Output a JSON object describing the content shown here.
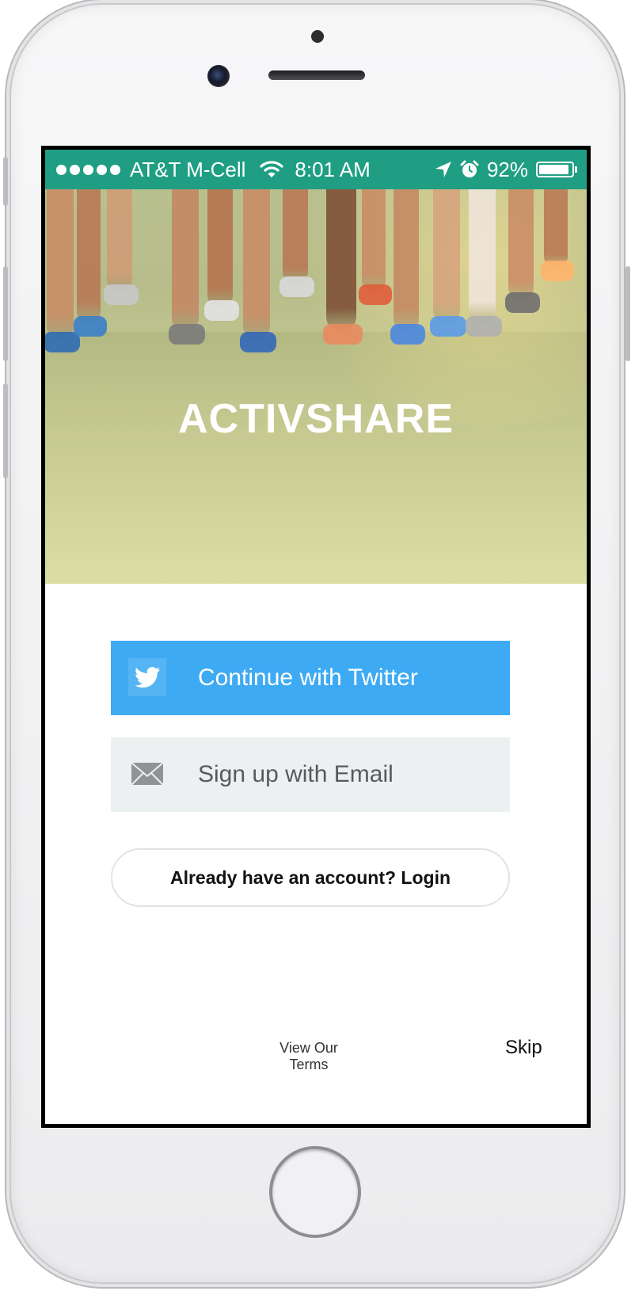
{
  "status_bar": {
    "carrier": "AT&T M-Cell",
    "time": "8:01 AM",
    "battery_percent_label": "92%",
    "battery_level": 0.92,
    "signal_bars": 5,
    "icons": [
      "signal-dots-icon",
      "wifi-icon",
      "location-arrow-icon",
      "alarm-icon",
      "battery-icon"
    ],
    "background_color": "#1f9e83"
  },
  "hero": {
    "brand_name": "ACTIVSHARE",
    "image": "runners-legs-photo"
  },
  "actions": {
    "twitter_label": "Continue with Twitter",
    "twitter_icon": "twitter-bird-icon",
    "twitter_color": "#3eaaf3",
    "email_label": "Sign up with Email",
    "email_icon": "envelope-icon",
    "login_label": "Already have an account? Login"
  },
  "footer": {
    "terms_label": "View Our Terms",
    "skip_label": "Skip"
  }
}
